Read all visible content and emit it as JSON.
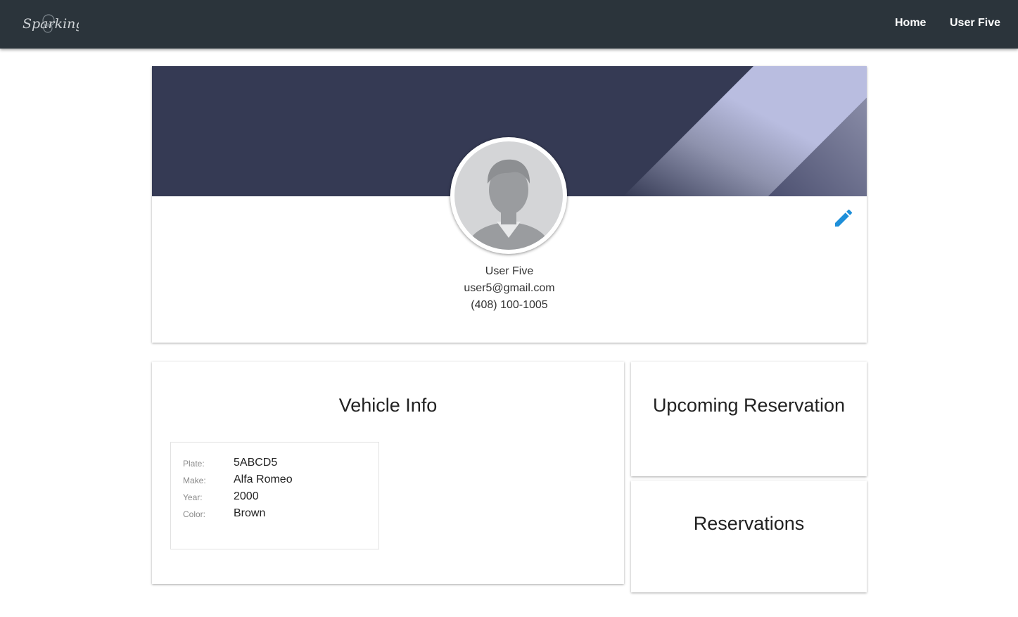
{
  "navbar": {
    "logo_text": "Sparking",
    "links": {
      "home": "Home",
      "user": "User Five"
    }
  },
  "profile": {
    "name": "User Five",
    "email": "user5@gmail.com",
    "phone": "(408) 100-1005",
    "edit_icon": "pencil-icon"
  },
  "vehicle": {
    "title": "Vehicle Info",
    "fields": [
      {
        "label": "Plate:",
        "value": "5ABCD5"
      },
      {
        "label": "Make:",
        "value": "Alfa Romeo"
      },
      {
        "label": "Year:",
        "value": "2000"
      },
      {
        "label": "Color:",
        "value": "Brown"
      }
    ]
  },
  "upcoming": {
    "title": "Upcoming Reservation"
  },
  "reservations": {
    "title": "Reservations"
  },
  "colors": {
    "navbar_bg": "#2b343b",
    "banner_bg": "#353a54",
    "banner_stripe": "#b9bde0",
    "edit_icon": "#1e8fd9"
  }
}
